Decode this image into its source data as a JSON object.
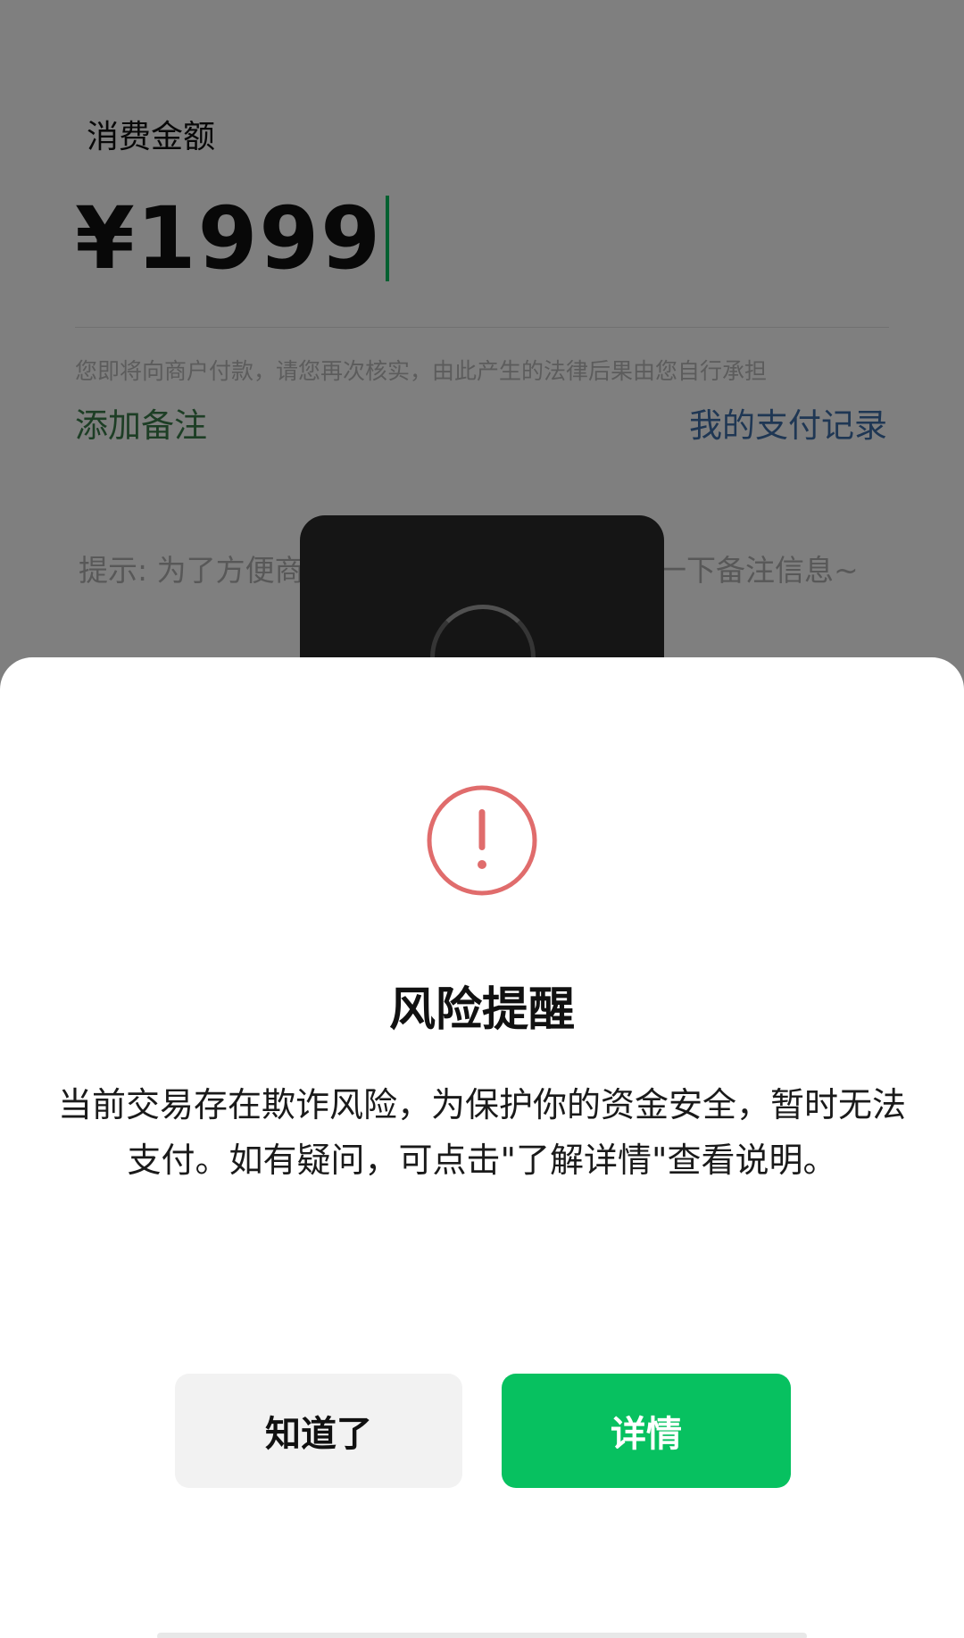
{
  "background": {
    "amount_label": "消费金额",
    "amount_value": "¥1999",
    "disclaimer": "您即将向商户付款，请您再次核实，由此产生的法律后果由您自行承担",
    "add_note_link": "添加备注",
    "pay_records_link": "我的支付记录",
    "hint_left": "提示: 为了方便商",
    "hint_right": "一下备注信息~"
  },
  "dialog": {
    "icon": "exclamation-circle-icon",
    "title": "风险提醒",
    "message": "当前交易存在欺诈风险，为保护你的资金安全，暂时无法支付。如有疑问，可点击\"了解详情\"查看说明。",
    "ack_button": "知道了",
    "detail_button": "详情"
  },
  "colors": {
    "accent_green": "#07c160",
    "warning_red": "#e06c6c",
    "link_blue": "#3f6fa8"
  }
}
